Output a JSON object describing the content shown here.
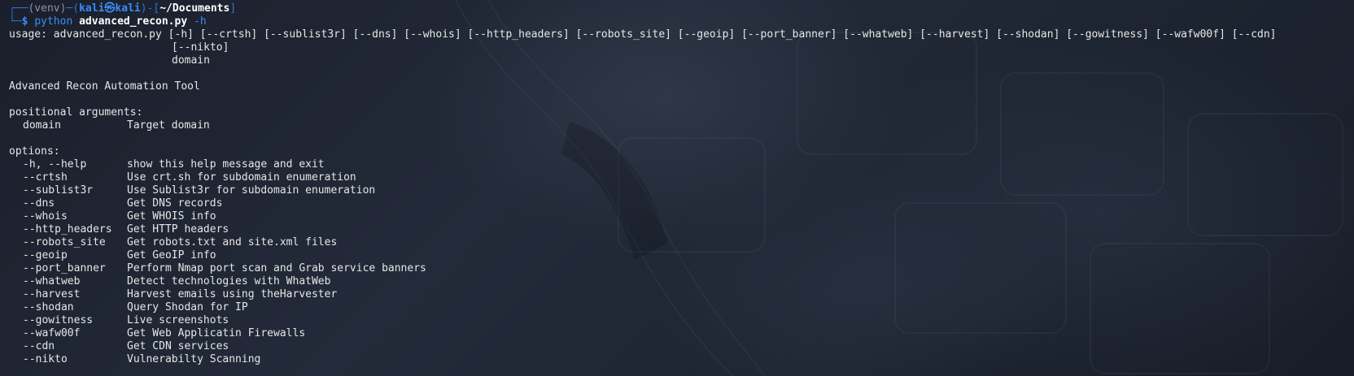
{
  "prompt": {
    "frame_top": "┌──",
    "venv": "(venv)",
    "dash": "─",
    "user_open": "(",
    "user": "kali㉿kali",
    "user_close": ")",
    "path_open": "-[",
    "path": "~/Documents",
    "path_close": "]",
    "frame_bottom": "└─",
    "dollar": "$",
    "command": "python",
    "script": "advanced_recon.py",
    "flag": "-h"
  },
  "usage": {
    "line1": "usage: advanced_recon.py [-h] [--crtsh] [--sublist3r] [--dns] [--whois] [--http_headers] [--robots_site] [--geoip] [--port_banner] [--whatweb] [--harvest] [--shodan] [--gowitness] [--wafw00f] [--cdn]",
    "line2": "[--nikto]",
    "line3": "domain"
  },
  "description": "Advanced Recon Automation Tool",
  "positional": {
    "header": "positional arguments:",
    "args": [
      {
        "flag": "domain",
        "desc": "Target domain"
      }
    ]
  },
  "options": {
    "header": "options:",
    "items": [
      {
        "flag": "-h, --help",
        "desc": "show this help message and exit"
      },
      {
        "flag": "--crtsh",
        "desc": "Use crt.sh for subdomain enumeration"
      },
      {
        "flag": "--sublist3r",
        "desc": "Use Sublist3r for subdomain enumeration"
      },
      {
        "flag": "--dns",
        "desc": "Get DNS records"
      },
      {
        "flag": "--whois",
        "desc": "Get WHOIS info"
      },
      {
        "flag": "--http_headers",
        "desc": "Get HTTP headers"
      },
      {
        "flag": "--robots_site",
        "desc": "Get robots.txt and site.xml files"
      },
      {
        "flag": "--geoip",
        "desc": "Get GeoIP info"
      },
      {
        "flag": "--port_banner",
        "desc": "Perform Nmap port scan and Grab service banners"
      },
      {
        "flag": "--whatweb",
        "desc": "Detect technologies with WhatWeb"
      },
      {
        "flag": "--harvest",
        "desc": "Harvest emails using theHarvester"
      },
      {
        "flag": "--shodan",
        "desc": "Query Shodan for IP"
      },
      {
        "flag": "--gowitness",
        "desc": "Live screenshots"
      },
      {
        "flag": "--wafw00f",
        "desc": "Get Web Applicatin Firewalls"
      },
      {
        "flag": "--cdn",
        "desc": "Get CDN services"
      },
      {
        "flag": "--nikto",
        "desc": "Vulnerabilty Scanning"
      }
    ]
  },
  "colors": {
    "background": "#1c2230",
    "text": "#e6e6e6",
    "prompt_blue": "#3b8df5",
    "frame_blue": "#2f73d6"
  }
}
